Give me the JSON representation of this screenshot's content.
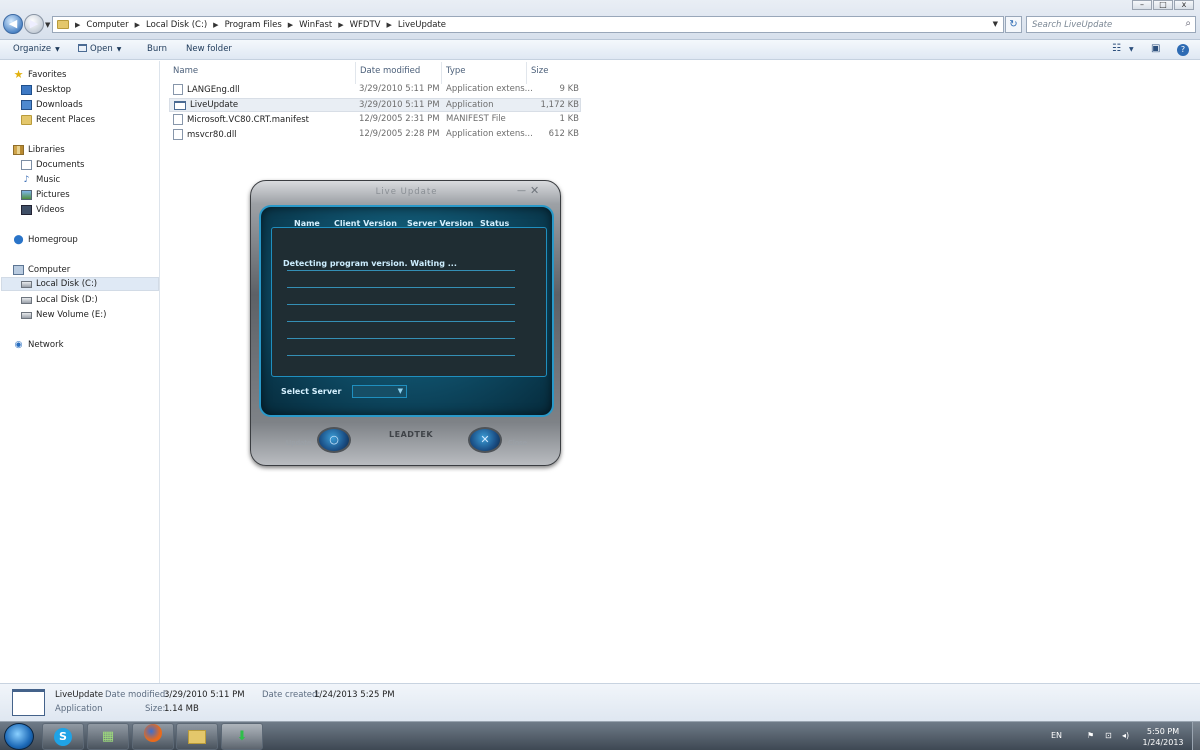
{
  "address_bar": {
    "crumbs": [
      "Computer",
      "Local Disk (C:)",
      "Program Files",
      "WinFast",
      "WFDTV",
      "LiveUpdate"
    ],
    "search_placeholder": "Search LiveUpdate"
  },
  "toolbar": {
    "organize": "Organize",
    "open": "Open",
    "burn": "Burn",
    "new_folder": "New folder"
  },
  "nav": {
    "favorites": "Favorites",
    "desktop": "Desktop",
    "downloads": "Downloads",
    "recent_places": "Recent Places",
    "libraries": "Libraries",
    "documents": "Documents",
    "music": "Music",
    "pictures": "Pictures",
    "videos": "Videos",
    "homegroup": "Homegroup",
    "computer": "Computer",
    "local_c": "Local Disk (C:)",
    "local_d": "Local Disk (D:)",
    "new_volume_e": "New Volume (E:)",
    "network": "Network"
  },
  "columns": {
    "name": "Name",
    "date_modified": "Date modified",
    "type": "Type",
    "size": "Size"
  },
  "files": [
    {
      "name": "LANGEng.dll",
      "date": "3/29/2010 5:11 PM",
      "type": "Application extens...",
      "size": "9 KB"
    },
    {
      "name": "LiveUpdate",
      "date": "3/29/2010 5:11 PM",
      "type": "Application",
      "size": "1,172 KB"
    },
    {
      "name": "Microsoft.VC80.CRT.manifest",
      "date": "12/9/2005 2:31 PM",
      "type": "MANIFEST File",
      "size": "1 KB"
    },
    {
      "name": "msvcr80.dll",
      "date": "12/9/2005 2:28 PM",
      "type": "Application extens...",
      "size": "612 KB"
    }
  ],
  "live_update": {
    "title": "Live Update",
    "headers": [
      "Name",
      "Client Version",
      "Server Version",
      "Status"
    ],
    "message": "Detecting program version. Waiting ...",
    "select_server_label": "Select Server",
    "update_label": "Update",
    "close_label": "Close",
    "brand": "LEADTEK"
  },
  "details": {
    "name": "LiveUpdate",
    "date_modified_label": "Date modified:",
    "date_modified": "3/29/2010 5:11 PM",
    "date_created_label": "Date created:",
    "date_created": "1/24/2013 5:25 PM",
    "type": "Application",
    "size_label": "Size:",
    "size": "1.14 MB"
  },
  "taskbar": {
    "language": "EN",
    "time": "5:50 PM",
    "date": "1/24/2013"
  }
}
